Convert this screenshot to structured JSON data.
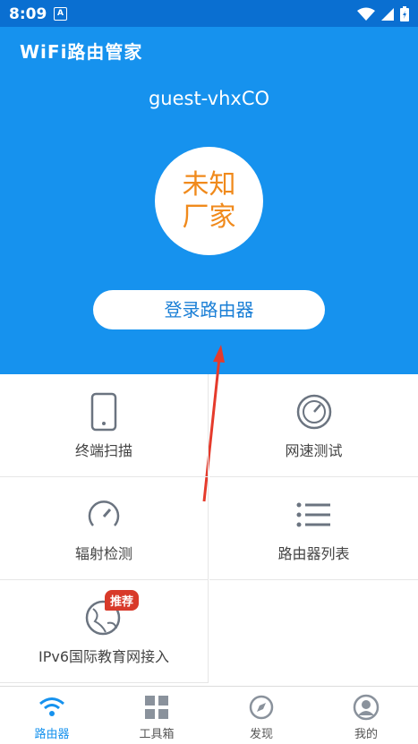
{
  "status_bar": {
    "time": "8:09",
    "notification_icon": "a-icon",
    "icons": [
      "wifi-icon",
      "signal-icon",
      "battery-icon"
    ]
  },
  "header": {
    "app_title": "WiFi路由管家",
    "ssid": "guest-vhxCO",
    "vendor": "未知厂家",
    "login_button": "登录路由器",
    "background_color": "#1692ee",
    "vendor_color": "#f08a1c"
  },
  "grid": [
    {
      "label": "终端扫描",
      "icon": "phone-icon"
    },
    {
      "label": "网速测试",
      "icon": "speedtest-icon"
    },
    {
      "label": "辐射检测",
      "icon": "gauge-icon"
    },
    {
      "label": "路由器列表",
      "icon": "list-icon"
    },
    {
      "label": "IPv6国际教育网接入",
      "icon": "globe-icon",
      "badge": "推荐"
    }
  ],
  "tabs": [
    {
      "label": "路由器",
      "icon": "wifi-icon",
      "active": true
    },
    {
      "label": "工具箱",
      "icon": "grid-icon",
      "active": false
    },
    {
      "label": "发现",
      "icon": "compass-icon",
      "active": false
    },
    {
      "label": "我的",
      "icon": "user-icon",
      "active": false
    }
  ]
}
